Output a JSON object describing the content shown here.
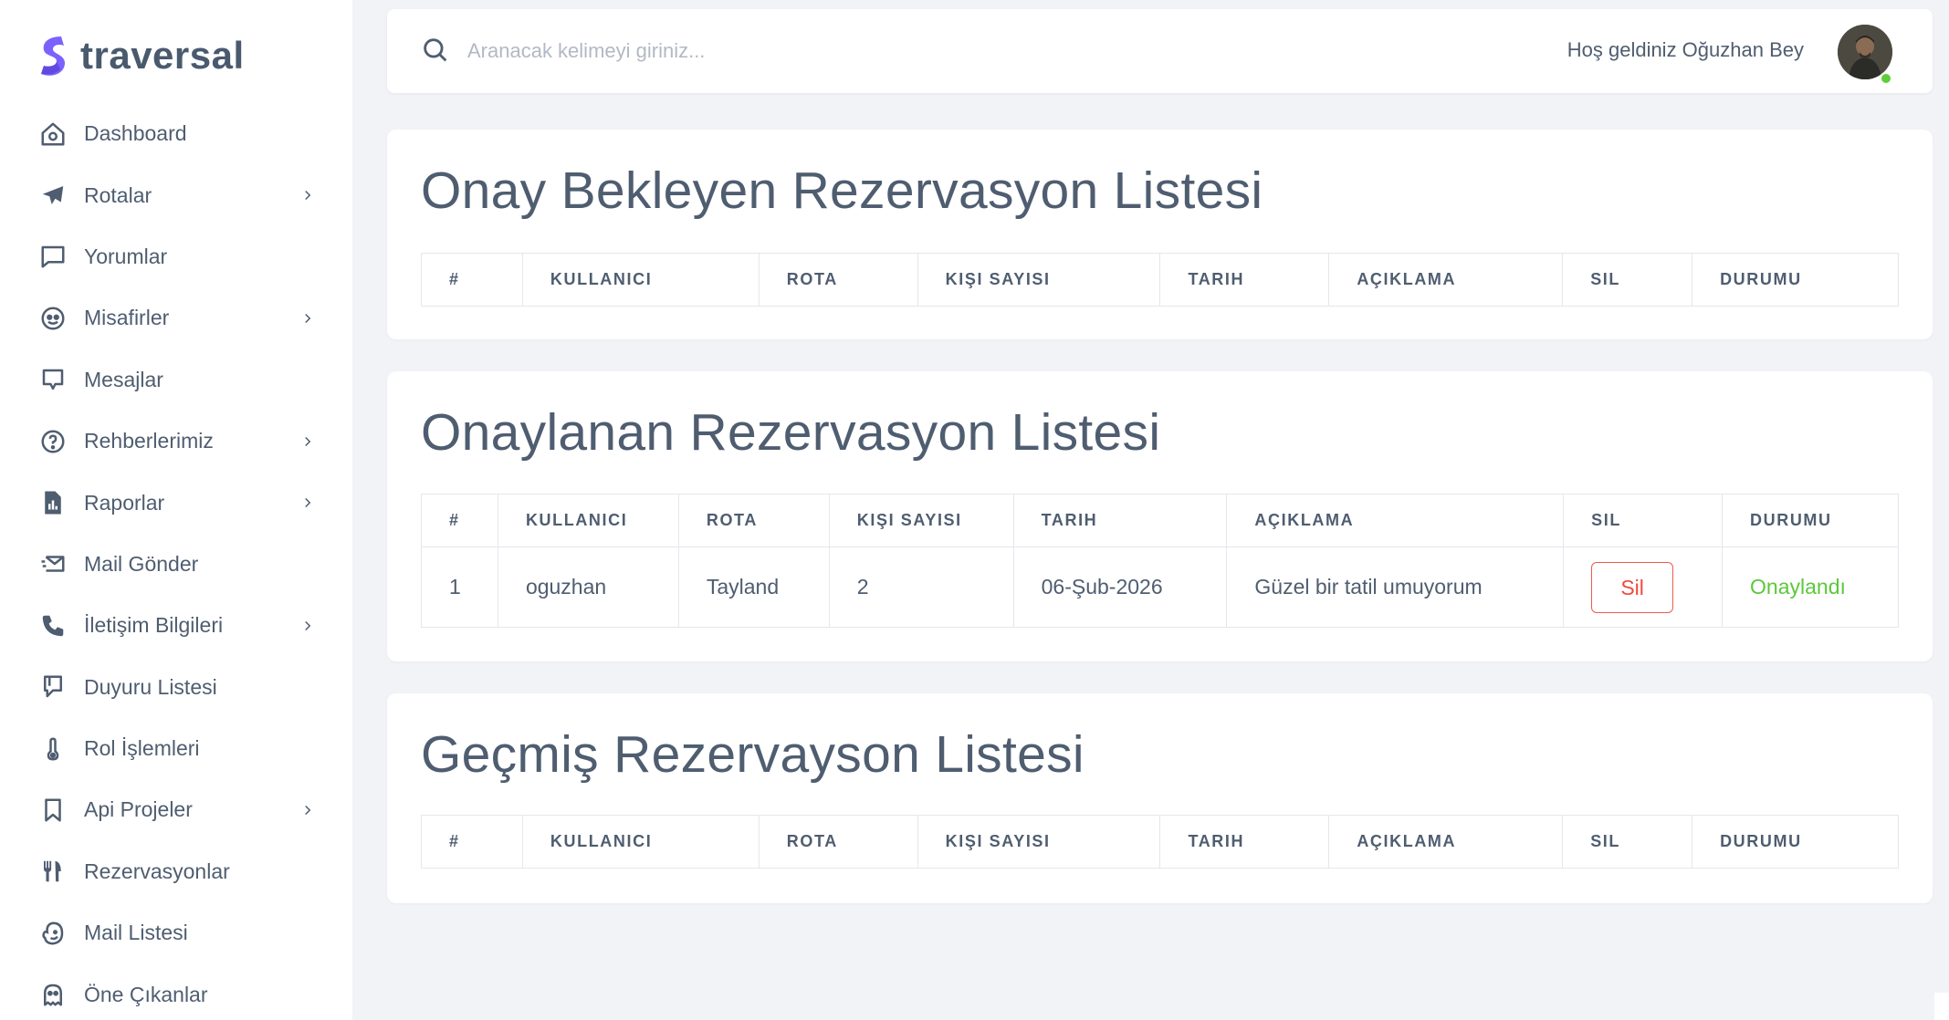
{
  "brand": {
    "name": "traversal",
    "accent": "#7b61ff"
  },
  "sidebar": {
    "items": [
      {
        "label": "Dashboard",
        "icon": "home-icon",
        "has_submenu": false
      },
      {
        "label": "Rotalar",
        "icon": "plane-icon",
        "has_submenu": true
      },
      {
        "label": "Yorumlar",
        "icon": "comment-icon",
        "has_submenu": false
      },
      {
        "label": "Misafirler",
        "icon": "face-icon",
        "has_submenu": true
      },
      {
        "label": "Mesajlar",
        "icon": "message-icon",
        "has_submenu": false
      },
      {
        "label": "Rehberlerimiz",
        "icon": "question-circle-icon",
        "has_submenu": true
      },
      {
        "label": "Raporlar",
        "icon": "report-icon",
        "has_submenu": true
      },
      {
        "label": "Mail Gönder",
        "icon": "mail-send-icon",
        "has_submenu": false
      },
      {
        "label": "İletişim Bilgileri",
        "icon": "phone-icon",
        "has_submenu": true
      },
      {
        "label": "Duyuru Listesi",
        "icon": "book-icon",
        "has_submenu": false
      },
      {
        "label": "Rol İşlemleri",
        "icon": "thermometer-icon",
        "has_submenu": false
      },
      {
        "label": "Api Projeler",
        "icon": "bookmark-icon",
        "has_submenu": true
      },
      {
        "label": "Rezervasyonlar",
        "icon": "fork-knife-icon",
        "has_submenu": false
      },
      {
        "label": "Mail Listesi",
        "icon": "mailchimp-icon",
        "has_submenu": false
      },
      {
        "label": "Öne Çıkanlar",
        "icon": "ghost-icon",
        "has_submenu": false
      }
    ]
  },
  "header": {
    "search_placeholder": "Aranacak kelimeyi giriniz...",
    "welcome": "Hoş geldiniz Oğuzhan Bey"
  },
  "pending": {
    "title": "Onay Bekleyen Rezervasyon Listesi",
    "columns": [
      "#",
      "KULLANICI",
      "ROTA",
      "KIŞI SAYISI",
      "TARIH",
      "AÇIKLAMA",
      "SIL",
      "DURUMU"
    ]
  },
  "approved": {
    "title": "Onaylanan Rezervasyon Listesi",
    "columns": [
      "#",
      "KULLANICI",
      "ROTA",
      "KIŞI SAYISI",
      "TARIH",
      "AÇIKLAMA",
      "SIL",
      "DURUMU"
    ],
    "rows": [
      {
        "no": "1",
        "user": "oguzhan",
        "route": "Tayland",
        "count": "2",
        "date": "06-Şub-2026",
        "desc": "Güzel bir tatil umuyorum",
        "delete_label": "Sil",
        "status": "Onaylandı"
      }
    ]
  },
  "past": {
    "title": "Geçmiş Rezervayson Listesi",
    "columns": [
      "#",
      "KULLANICI",
      "ROTA",
      "KIŞI SAYISI",
      "TARIH",
      "AÇIKLAMA",
      "SIL",
      "DURUMU"
    ]
  },
  "colors": {
    "delete": "#ee4a3d",
    "approved": "#5cc83a",
    "text": "#4f5d70"
  }
}
